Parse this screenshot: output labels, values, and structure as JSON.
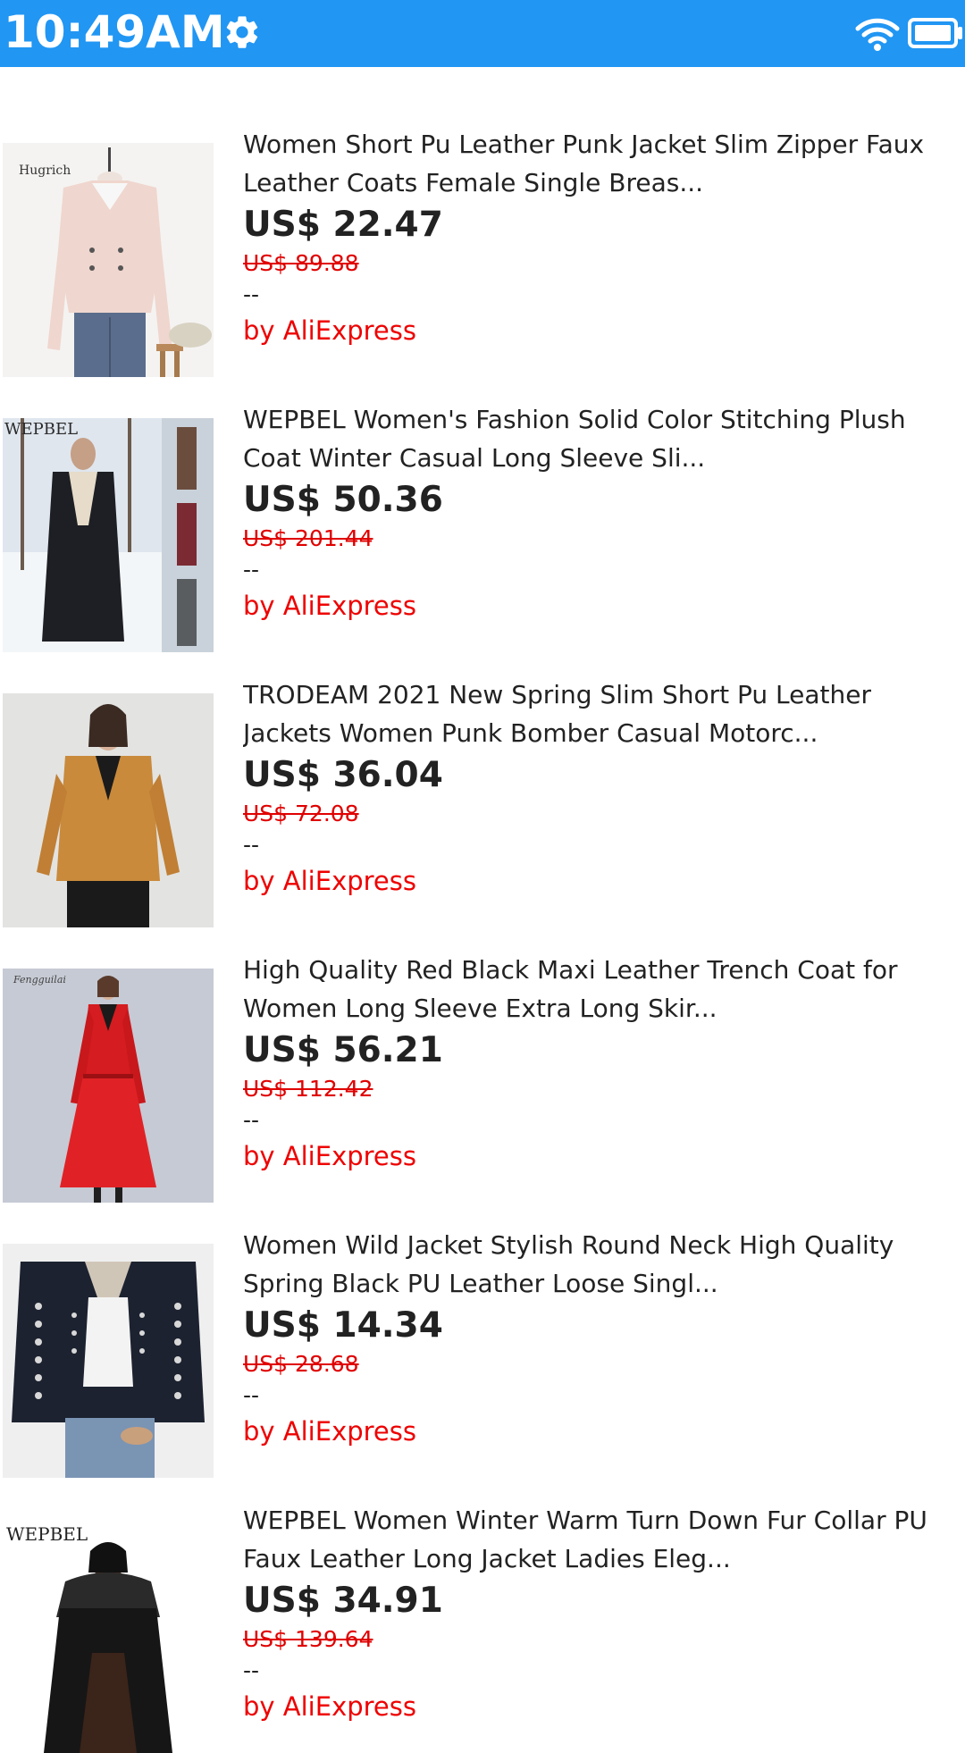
{
  "status_bar": {
    "time": "10:49AM",
    "icons": [
      "gear-icon",
      "wifi-icon",
      "battery-icon"
    ],
    "background_color": "#2196F3"
  },
  "products": [
    {
      "title": "Women Short Pu Leather Punk Jacket Slim Zipper Faux Leather Coats Female Single Breas...",
      "price": "US$ 22.47",
      "original_price": "US$ 89.88",
      "rating": "--",
      "seller": "by AliExpress",
      "image_brand": "Hugrich"
    },
    {
      "title": "WEPBEL Women's Fashion Solid Color Stitching Plush Coat Winter Casual Long Sleeve Sli...",
      "price": "US$ 50.36",
      "original_price": "US$ 201.44",
      "rating": "--",
      "seller": "by AliExpress",
      "image_brand": "WEPBEL"
    },
    {
      "title": "TRODEAM 2021 New Spring Slim Short Pu Leather Jackets Women Punk Bomber Casual Motorc...",
      "price": "US$ 36.04",
      "original_price": "US$ 72.08",
      "rating": "--",
      "seller": "by AliExpress",
      "image_brand": ""
    },
    {
      "title": "High Quality Red Black Maxi Leather Trench Coat for Women Long Sleeve Extra Long Skir...",
      "price": "US$ 56.21",
      "original_price": "US$ 112.42",
      "rating": "--",
      "seller": "by AliExpress",
      "image_brand": "Fengguilai"
    },
    {
      "title": "Women Wild Jacket Stylish Round Neck High Quality Spring Black PU Leather Loose Singl...",
      "price": "US$ 14.34",
      "original_price": "US$ 28.68",
      "rating": "--",
      "seller": "by AliExpress",
      "image_brand": ""
    },
    {
      "title": "WEPBEL Women Winter Warm Turn Down Fur Collar PU Faux Leather Long Jacket Ladies Eleg...",
      "price": "US$ 34.91",
      "original_price": "US$ 139.64",
      "rating": "--",
      "seller": "by AliExpress",
      "image_brand": "WEPBEL"
    }
  ]
}
